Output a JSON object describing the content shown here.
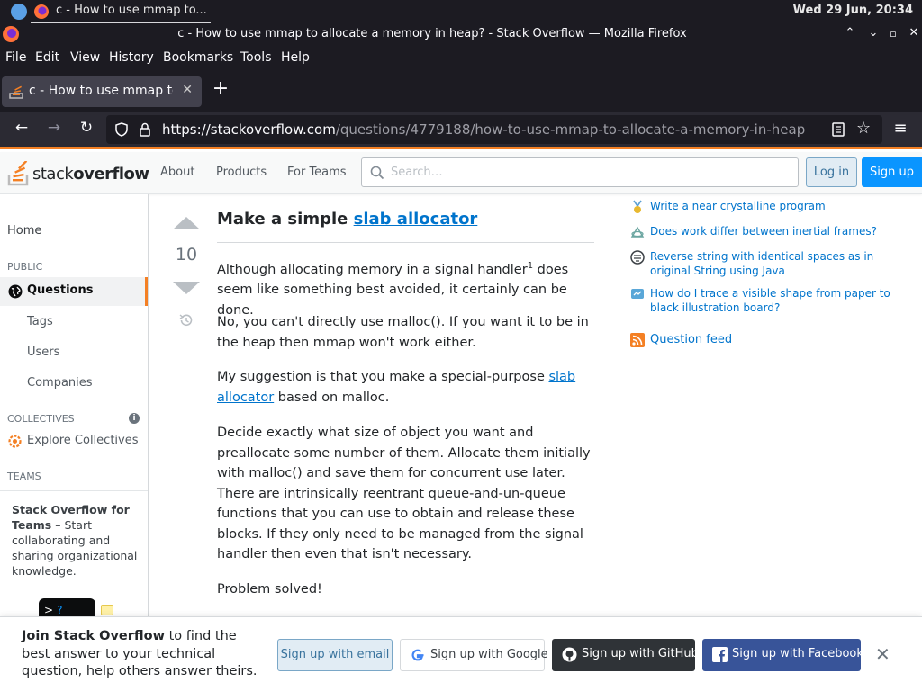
{
  "system": {
    "task_title": "c - How to use mmap to...",
    "clock": "Wed 29 Jun, 20:34"
  },
  "window": {
    "title": "c - How to use mmap to allocate a memory in heap? - Stack Overflow — Mozilla Firefox"
  },
  "menu": [
    "File",
    "Edit",
    "View",
    "History",
    "Bookmarks",
    "Tools",
    "Help"
  ],
  "tab": {
    "label": "c - How to use mmap to a"
  },
  "address": {
    "host": "https://stackoverflow.com",
    "path": "/questions/4779188/how-to-use-mmap-to-allocate-a-memory-in-heap"
  },
  "so_header": {
    "logo_light": "stack",
    "logo_bold": "overflow",
    "nav": [
      "About",
      "Products",
      "For Teams"
    ],
    "search_placeholder": "Search…",
    "login": "Log in",
    "signup": "Sign up"
  },
  "left_nav": {
    "home": "Home",
    "public_header": "PUBLIC",
    "questions": "Questions",
    "tags": "Tags",
    "users": "Users",
    "companies": "Companies",
    "collectives_header": "COLLECTIVES",
    "explore_collectives": "Explore Collectives",
    "teams_header": "TEAMS",
    "teams_bold": "Stack Overflow for Teams",
    "teams_text": " – Start collaborating and sharing organizational knowledge."
  },
  "answer": {
    "score": "10",
    "heading_prefix": "Make a simple ",
    "heading_link": "slab allocator",
    "p1_a": "Although allocating memory in a signal handler",
    "p1_sup": "1",
    "p1_b": " does seem like something best avoided, it certainly can be done.",
    "p2": "No, you can't directly use malloc(). If you want it to be in the heap then mmap won't work either.",
    "p3_a": "My suggestion is that you make a special-purpose ",
    "p3_link": "slab allocator",
    "p3_b": " based on malloc.",
    "p4": "Decide exactly what size of object you want and preallocate some number of them. Allocate them initially with malloc() and save them for concurrent use later. There are intrinsically reentrant queue-and-un-queue functions that you can use to obtain and release these blocks. If they only need to be managed from the signal handler then even that isn't necessary.",
    "p5": "Problem solved!"
  },
  "hot_questions": [
    "Write a near crystalline program",
    "Does work differ between inertial frames?",
    "Reverse string with identical spaces as in original String using Java",
    "How do I trace a visible shape from paper to black illustration board?"
  ],
  "question_feed": "Question feed",
  "banner": {
    "bold": "Join Stack Overflow",
    "text": " to find the best answer to your technical question, help others answer theirs.",
    "email": "Sign up with email",
    "google": "Sign up with Google",
    "github": "Sign up with GitHub",
    "facebook": "Sign up with Facebook"
  },
  "colors": {
    "so_orange": "#f48024",
    "so_blue": "#0a95ff",
    "link": "#0074cc",
    "firefox_dark": "#1c1b22"
  }
}
